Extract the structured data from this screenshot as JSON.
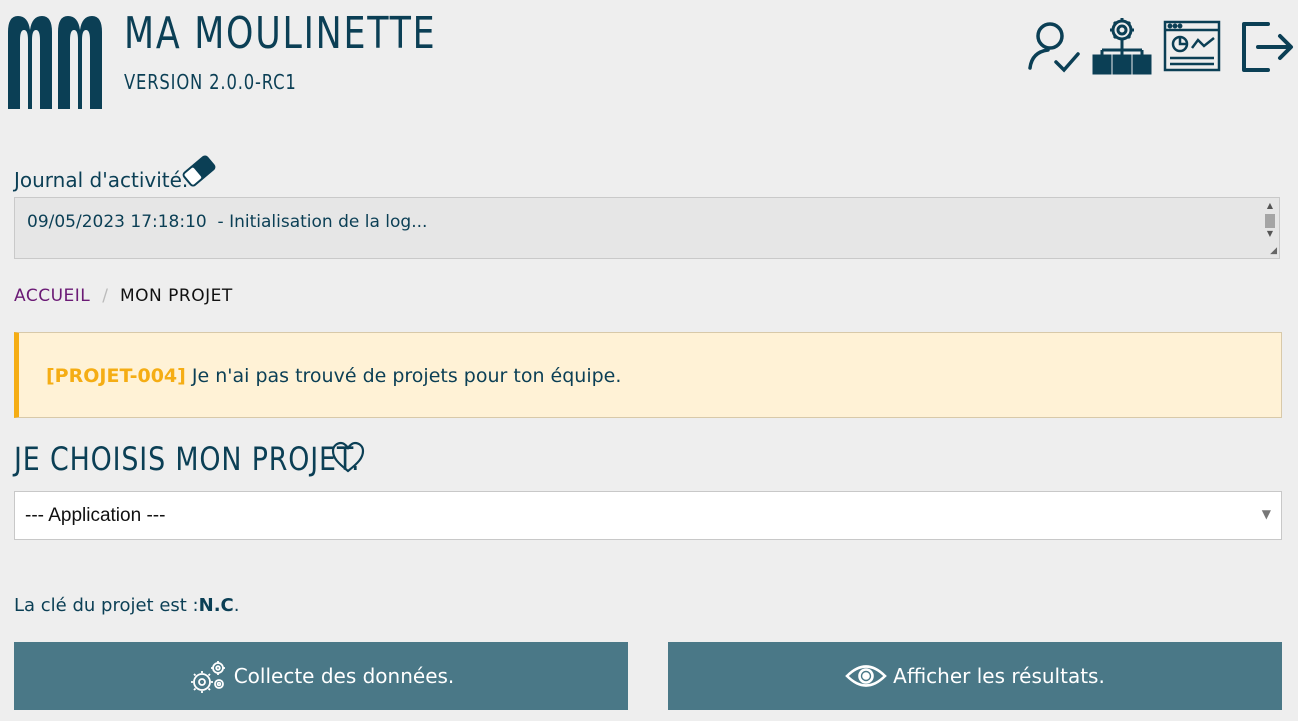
{
  "header": {
    "title": "MA MOULINETTE",
    "version": "VERSION 2.0.0-RC1",
    "icons": [
      "user-check-icon",
      "network-settings-icon",
      "dashboard-icon",
      "logout-icon"
    ]
  },
  "journal": {
    "label": "Journal d'activité.",
    "log_text": "09/05/2023 17:18:10  - Initialisation de la log..."
  },
  "breadcrumb": {
    "home": "ACCUEIL",
    "separator": "/",
    "current": "MON PROJET"
  },
  "alert": {
    "code": "[PROJET-004]",
    "message": " Je n'ai pas trouvé de projets pour ton équipe."
  },
  "project": {
    "title": "JE CHOISIS MON PROJET.",
    "select_value": "--- Application ---",
    "key_label": "La clé du projet est :",
    "key_value": "N.C",
    "key_suffix": "."
  },
  "actions": {
    "collect_label": "Collecte des données.",
    "results_label": "Afficher les résultats."
  },
  "colors": {
    "primary": "#0b3f55",
    "button": "#4a7887",
    "alert_bg": "#fff2d6",
    "alert_accent": "#f5ad14",
    "breadcrumb_link": "#6b1a75"
  }
}
